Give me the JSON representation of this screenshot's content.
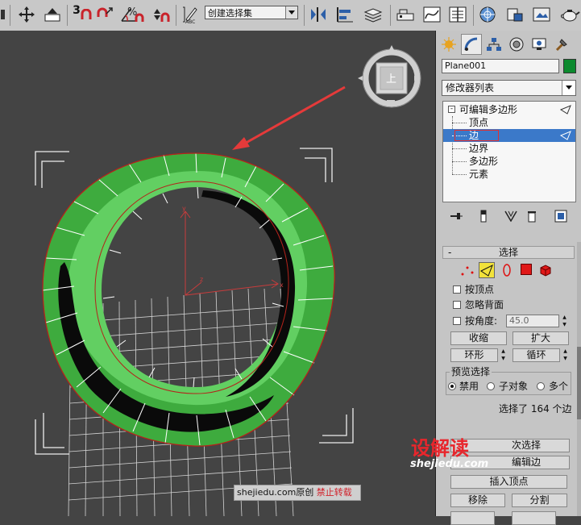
{
  "toolbar": {
    "snap_value": "3",
    "selection_set": "创建选择集",
    "colors": {
      "bg": "#c8c8c8",
      "red_icon": "#c9232b",
      "blue_icon": "#2c5fa8"
    }
  },
  "viewcube": {
    "label": "上"
  },
  "panel": {
    "object_name": "Plane001",
    "object_color": "#0b8a2e",
    "modifier_list": "修改器列表",
    "stack": {
      "root": "可编辑多边形",
      "items": [
        "顶点",
        "边",
        "边界",
        "多边形",
        "元素"
      ],
      "selected_index": 1
    },
    "selection": {
      "title": "选择",
      "collapse": "-",
      "by_vertex": "按顶点",
      "ignore_backfacing": "忽略背面",
      "by_angle": "按角度:",
      "angle_value": "45.0",
      "shrink": "收缩",
      "grow": "扩大",
      "ring": "环形",
      "loop": "循环",
      "preview_title": "预览选择",
      "preview_options": [
        "禁用",
        "子对象",
        "多个"
      ],
      "status": "选择了 164 个边"
    },
    "lower": {
      "soft_selection": "次选择",
      "edit_edges": "编辑边",
      "insert_vertex": "插入顶点",
      "remove": "移除",
      "split": "分割"
    }
  },
  "watermark": {
    "brand": "设解读",
    "domain": "shejiedu.com",
    "strip_a": "shejiedu.com原创",
    "strip_b": "禁止转载"
  }
}
